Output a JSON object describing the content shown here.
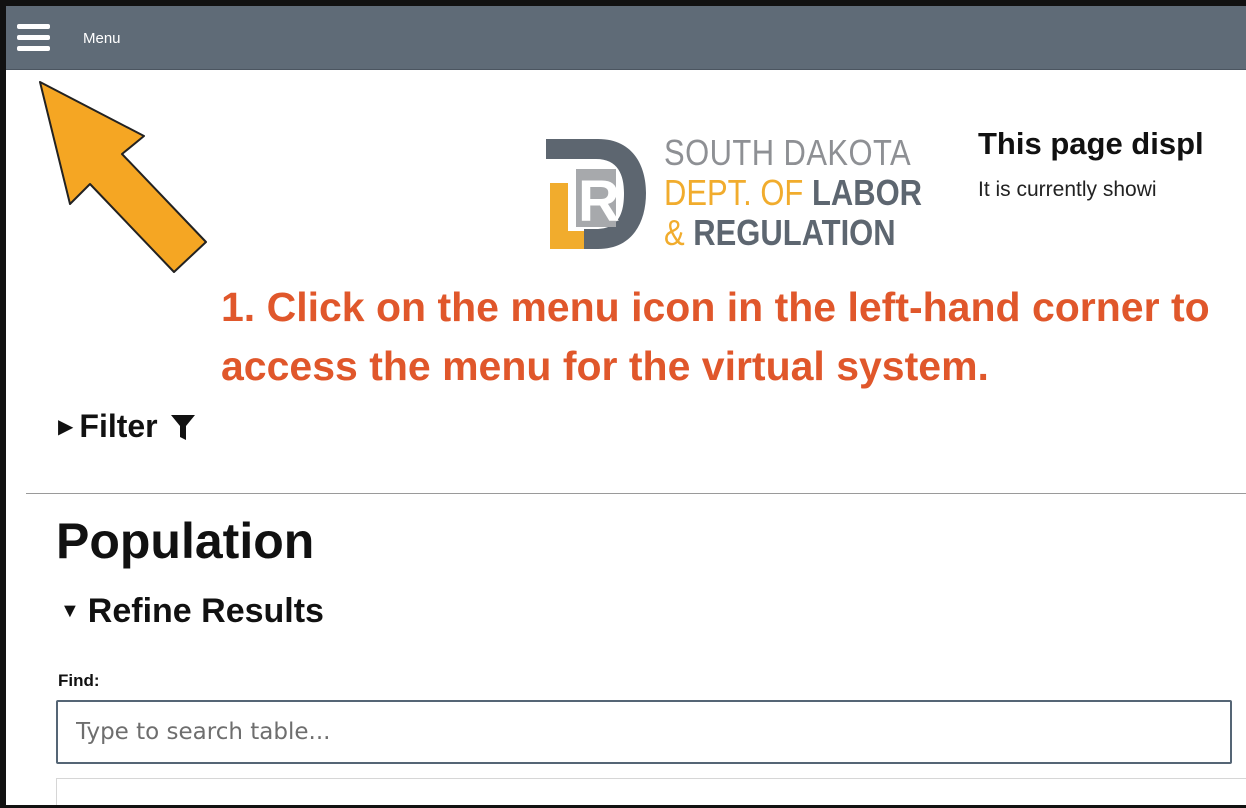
{
  "topbar": {
    "menu_label": "Menu",
    "background": "#5f6b77"
  },
  "logo": {
    "line1": "SOUTH DAKOTA",
    "line2_prefix": "DEPT. OF ",
    "line2_bold": "LABOR",
    "line3_amp": "& ",
    "line3_bold": "REGULATION",
    "colors": {
      "orange": "#f1ac2d",
      "gray": "#8e9094",
      "dark": "#5d6670"
    }
  },
  "header": {
    "title": "This page displ",
    "subtitle": "It is currently showi"
  },
  "annotation": {
    "text": "1. Click on the menu icon in the left-hand corner to access the menu for the virtual system.",
    "color": "#e0572b",
    "arrow_color": "#f5a623"
  },
  "filter": {
    "label": "Filter",
    "icon": "funnel-icon"
  },
  "main": {
    "title": "Population",
    "refine_label": "Refine Results",
    "find_label": "Find:",
    "search_placeholder": "Type to search table..."
  }
}
